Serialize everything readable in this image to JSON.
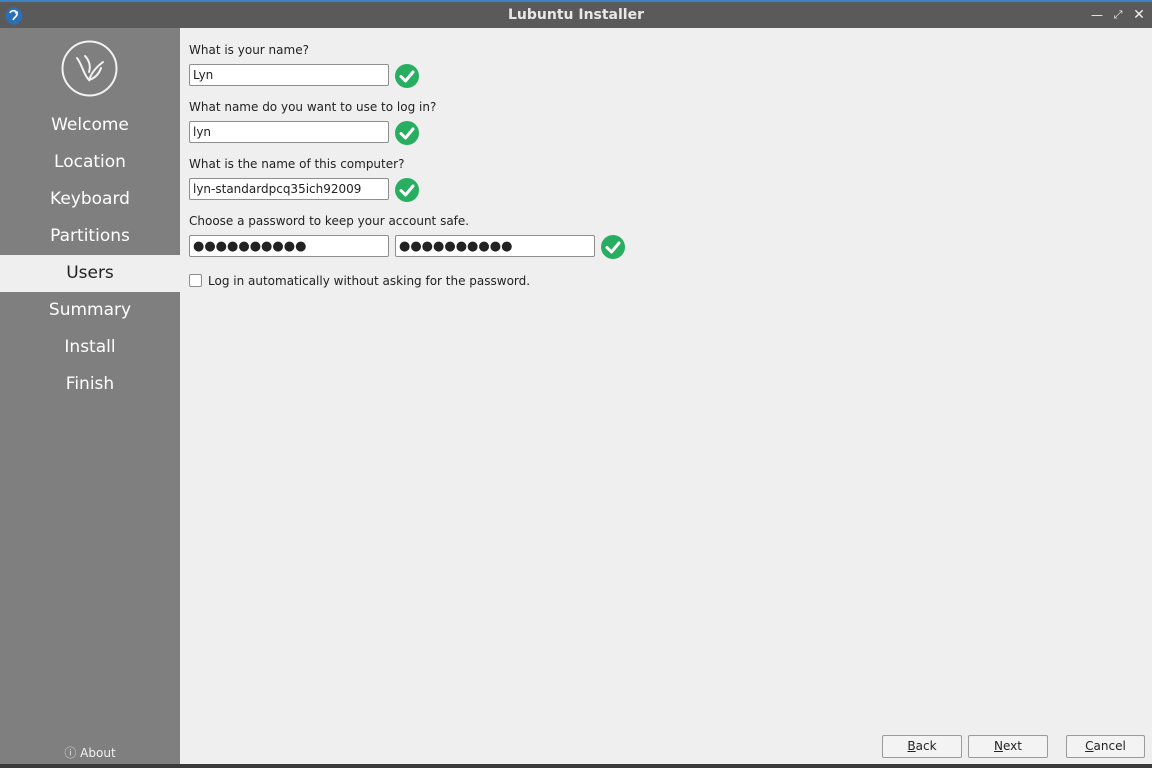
{
  "window": {
    "title": "Lubuntu Installer",
    "icons": {
      "app": "lubuntu-logo-icon",
      "minimize": "minimize-icon",
      "maximize": "maximize-icon",
      "close": "close-icon"
    }
  },
  "sidebar": {
    "logo": "lubuntu-bird-logo",
    "items": [
      {
        "label": "Welcome"
      },
      {
        "label": "Location"
      },
      {
        "label": "Keyboard"
      },
      {
        "label": "Partitions"
      },
      {
        "label": "Users",
        "active": true
      },
      {
        "label": "Summary"
      },
      {
        "label": "Install"
      },
      {
        "label": "Finish"
      }
    ],
    "about": {
      "icon": "info-icon",
      "label": "About"
    }
  },
  "form": {
    "name_label": "What is your name?",
    "name_value": "Lyn",
    "login_label": "What name do you want to use to log in?",
    "login_value": "lyn",
    "computer_label": "What is the name of this computer?",
    "computer_value": "lyn-standardpcq35ich92009",
    "password_label": "Choose a password to keep your account safe.",
    "password_value": "●●●●●●●●●●",
    "password_confirm_value": "●●●●●●●●●●",
    "autologin_label": "Log in automatically without asking for the password.",
    "autologin_checked": false,
    "valid_icon": "green-check-icon",
    "valid_color": "#27ae60"
  },
  "buttons": {
    "back_first": "B",
    "back_rest": "ack",
    "next_first": "N",
    "next_rest": "ext",
    "cancel_first": "C",
    "cancel_rest": "ancel"
  }
}
